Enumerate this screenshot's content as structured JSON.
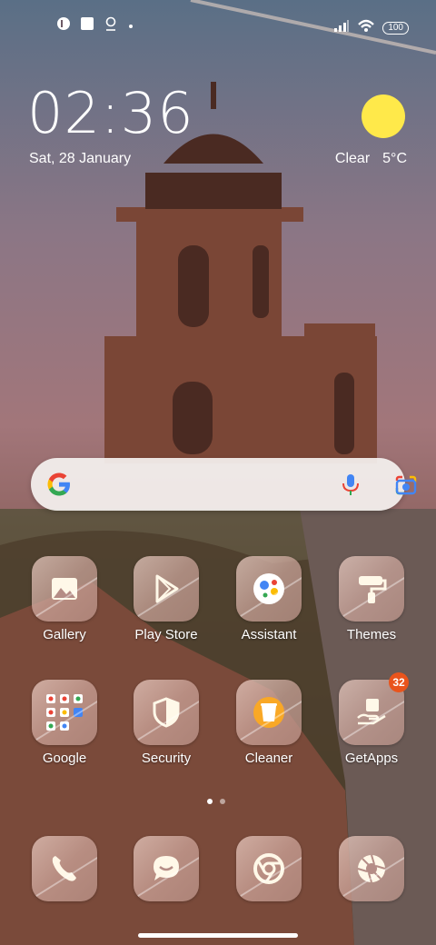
{
  "status_bar": {
    "battery": "100",
    "icons": [
      "app-badge-icon",
      "square-notification-icon",
      "location-icon",
      "dot-icon",
      "signal-icon",
      "wifi-icon",
      "battery-icon"
    ]
  },
  "clock": {
    "time": "02:36",
    "date": "Sat, 28 January"
  },
  "weather": {
    "condition": "Clear",
    "temperature": "5°C",
    "icon": "sun-icon"
  },
  "search": {
    "icons": [
      "google-g-icon",
      "microphone-icon",
      "lens-camera-icon"
    ]
  },
  "apps": [
    {
      "label": "Gallery",
      "icon": "gallery-icon"
    },
    {
      "label": "Play Store",
      "icon": "play-store-icon"
    },
    {
      "label": "Assistant",
      "icon": "assistant-icon"
    },
    {
      "label": "Themes",
      "icon": "paint-roller-icon"
    },
    {
      "label": "Google",
      "icon": "folder-icon"
    },
    {
      "label": "Security",
      "icon": "shield-icon"
    },
    {
      "label": "Cleaner",
      "icon": "trash-bin-icon"
    },
    {
      "label": "GetApps",
      "icon": "getapps-icon",
      "badge": "32"
    }
  ],
  "dock": [
    {
      "icon": "phone-icon"
    },
    {
      "icon": "message-icon"
    },
    {
      "icon": "chrome-icon"
    },
    {
      "icon": "camera-aperture-icon"
    }
  ],
  "colors": {
    "badge": "#e9541c",
    "sun": "#ffe94a"
  }
}
